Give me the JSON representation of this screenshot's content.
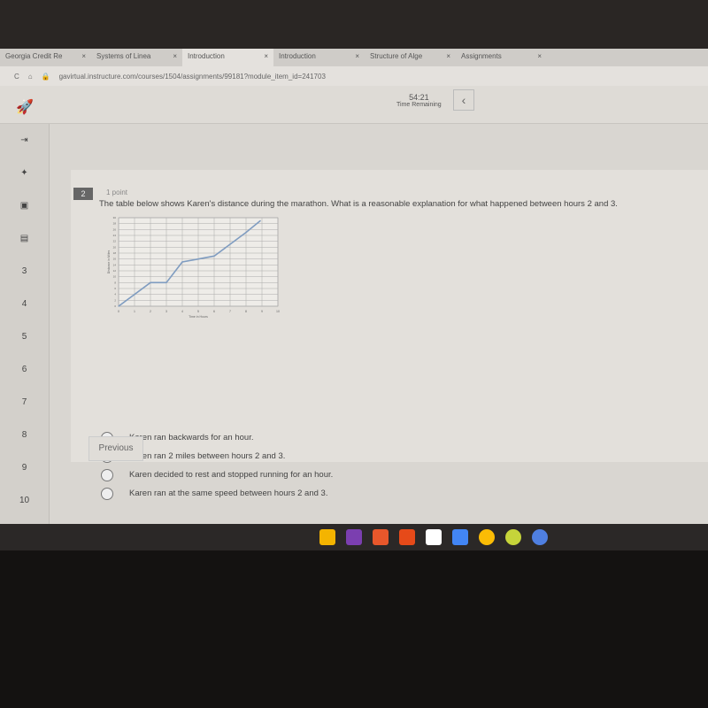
{
  "browser": {
    "tabs": [
      "Georgia Credit Re",
      "Systems of Linea",
      "Introduction",
      "Introduction",
      "Structure of Alge",
      "Assignments"
    ],
    "url": "gavirtual.instructure.com/courses/1504/assignments/99181?module_item_id=241703"
  },
  "timer": {
    "value": "54:21",
    "label": "Time Remaining"
  },
  "sidebar": {
    "items": [
      "3",
      "4",
      "5",
      "6",
      "7",
      "8",
      "9",
      "10"
    ]
  },
  "question": {
    "number": "2",
    "points": "1 point",
    "text": "The table below shows Karen's distance during the marathon. What is a reasonable explanation for what happened between hours 2 and 3.",
    "options": [
      "Karen ran backwards for an hour.",
      "Karen ran 2 miles between hours 2 and 3.",
      "Karen decided to rest and stopped running for an hour.",
      "Karen ran at the same speed between hours 2 and 3."
    ]
  },
  "nav": {
    "previous": "Previous"
  },
  "chart_data": {
    "type": "line",
    "xlabel": "Time in Hours",
    "ylabel": "Distance in Miles",
    "xlim": [
      0,
      10
    ],
    "ylim": [
      0,
      30
    ],
    "grid": true,
    "x": [
      0,
      2,
      3,
      4,
      5,
      6,
      7,
      8,
      8.9
    ],
    "y": [
      0,
      8,
      8,
      15,
      16,
      17,
      21,
      25,
      29
    ],
    "xticks": [
      "0",
      "1",
      "2",
      "3",
      "4",
      "5",
      "6",
      "7",
      "8",
      "9",
      "10"
    ],
    "yticks": [
      "0",
      "2",
      "4",
      "6",
      "8",
      "10",
      "12",
      "14",
      "16",
      "18",
      "20",
      "22",
      "24",
      "26",
      "28",
      "30"
    ],
    "line_color": "#7f9cc0"
  },
  "taskbar": {
    "icons": [
      "drive-icon",
      "onenote-icon",
      "photos-icon",
      "office-icon",
      "gmail-icon",
      "docs-icon",
      "chrome-icon",
      "timer-app-icon",
      "settings-icon"
    ]
  }
}
